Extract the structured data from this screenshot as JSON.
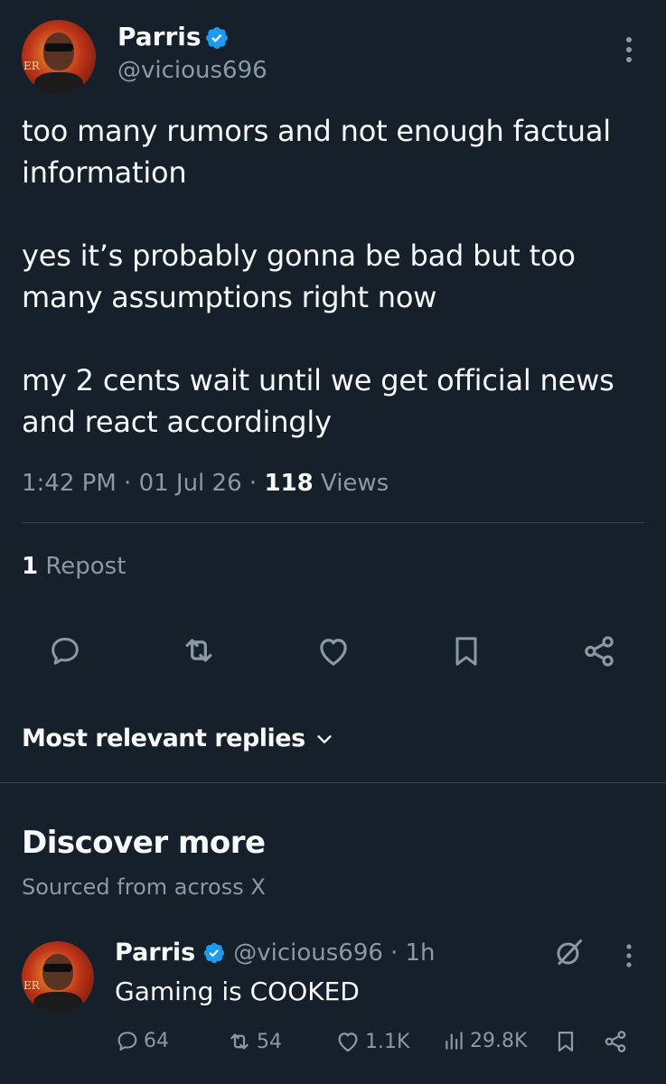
{
  "tweet": {
    "author_name": "Parris",
    "handle": "@vicious696",
    "avatar_text": "ER",
    "text": "too many rumors and not enough factual information\n\nyes it’s probably gonna be bad but too many assumptions right now\n\nmy 2 cents wait until we get official news and react accordingly",
    "time": "1:42 PM",
    "date": "01 Jul 26",
    "separator": "·",
    "views_count": "118",
    "views_label": "Views",
    "reposts_count": "1",
    "reposts_label": "Repost"
  },
  "actions": {
    "icons": [
      "reply-icon",
      "retweet-icon",
      "like-icon",
      "bookmark-icon",
      "share-icon"
    ]
  },
  "replies_filter": {
    "label": "Most relevant replies"
  },
  "discover": {
    "title": "Discover more",
    "subtitle": "Sourced from across X"
  },
  "discover_tweet": {
    "author_name": "Parris",
    "handle": "@vicious696",
    "time_ago": "· 1h",
    "avatar_text": "ER",
    "text": "Gaming is COOKED",
    "replies": "64",
    "reposts": "54",
    "likes": "1.1K",
    "views": "29.8K"
  },
  "colors": {
    "background": "#15202b",
    "text": "#f7f9f9",
    "secondary": "#8b98a5",
    "divider": "#38444d",
    "verified": "#1d9bf0"
  }
}
